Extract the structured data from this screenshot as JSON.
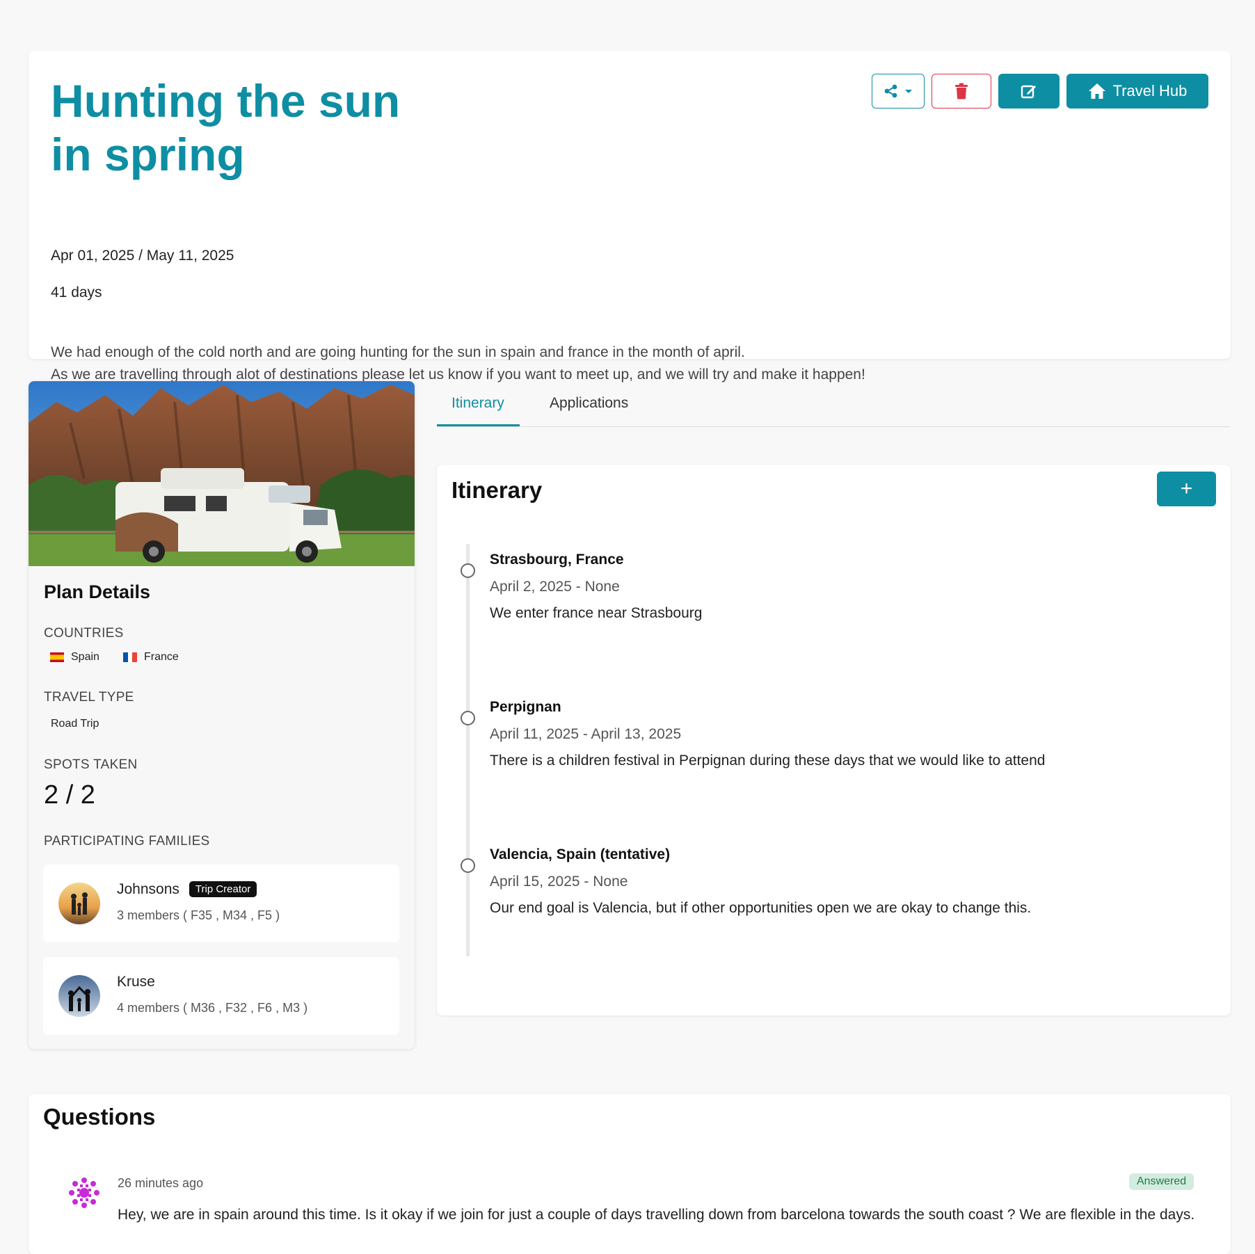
{
  "trip": {
    "title": "Hunting the sun in spring",
    "dates": "Apr 01, 2025 / May 11, 2025",
    "duration": "41 days",
    "description_line1": "We had enough of the cold north and are going hunting for the sun in spain and france in the month of april.",
    "description_line2": "As we are travelling through alot of destinations please let us know if you want to meet up, and we will try and make it happen!"
  },
  "toolbar": {
    "share_icon": "share-icon",
    "delete_icon": "trash-icon",
    "edit_icon": "edit-icon",
    "hub_label": "Travel Hub",
    "hub_icon": "home-icon"
  },
  "plan": {
    "title": "Plan Details",
    "countries_label": "COUNTRIES",
    "countries": [
      {
        "name": "Spain",
        "flag": "flag-spain-icon"
      },
      {
        "name": "France",
        "flag": "flag-france-icon"
      }
    ],
    "travel_type_label": "TRAVEL TYPE",
    "travel_type": "Road Trip",
    "spots_label": "SPOTS TAKEN",
    "spots": "2 / 2",
    "families_label": "PARTICIPATING FAMILIES",
    "families": [
      {
        "name": "Johnsons",
        "badge": "Trip Creator",
        "members": "3 members ( F35 , M34 , F5 )"
      },
      {
        "name": "Kruse",
        "members": "4 members ( M36 , F32 , F6 , M3 )"
      }
    ]
  },
  "tabs": [
    {
      "label": "Itinerary",
      "active": true
    },
    {
      "label": "Applications",
      "active": false
    }
  ],
  "itinerary": {
    "title": "Itinerary",
    "add_label": "+",
    "items": [
      {
        "name": "Strasbourg, France",
        "dates": "April 2, 2025 - None",
        "note": "We enter france near Strasbourg"
      },
      {
        "name": "Perpignan",
        "dates": "April 11, 2025 - April 13, 2025",
        "note": "There is a children festival in Perpignan during these days that we would like to attend"
      },
      {
        "name": "Valencia, Spain (tentative)",
        "dates": "April 15, 2025 - None",
        "note": "Our end goal is Valencia, but if other opportunities open we are okay to change this."
      }
    ]
  },
  "questions": {
    "title": "Questions",
    "items": [
      {
        "time": "26 minutes ago",
        "status": "Answered",
        "text": "Hey, we are in spain around this time. Is it okay if we join for just a couple of days travelling down from barcelona towards the south coast ? We are flexible in the days."
      }
    ]
  },
  "colors": {
    "accent": "#0e8ea3",
    "danger": "#dc3545",
    "answered_bg": "#d4ecdf",
    "answered_fg": "#1e7b45"
  }
}
